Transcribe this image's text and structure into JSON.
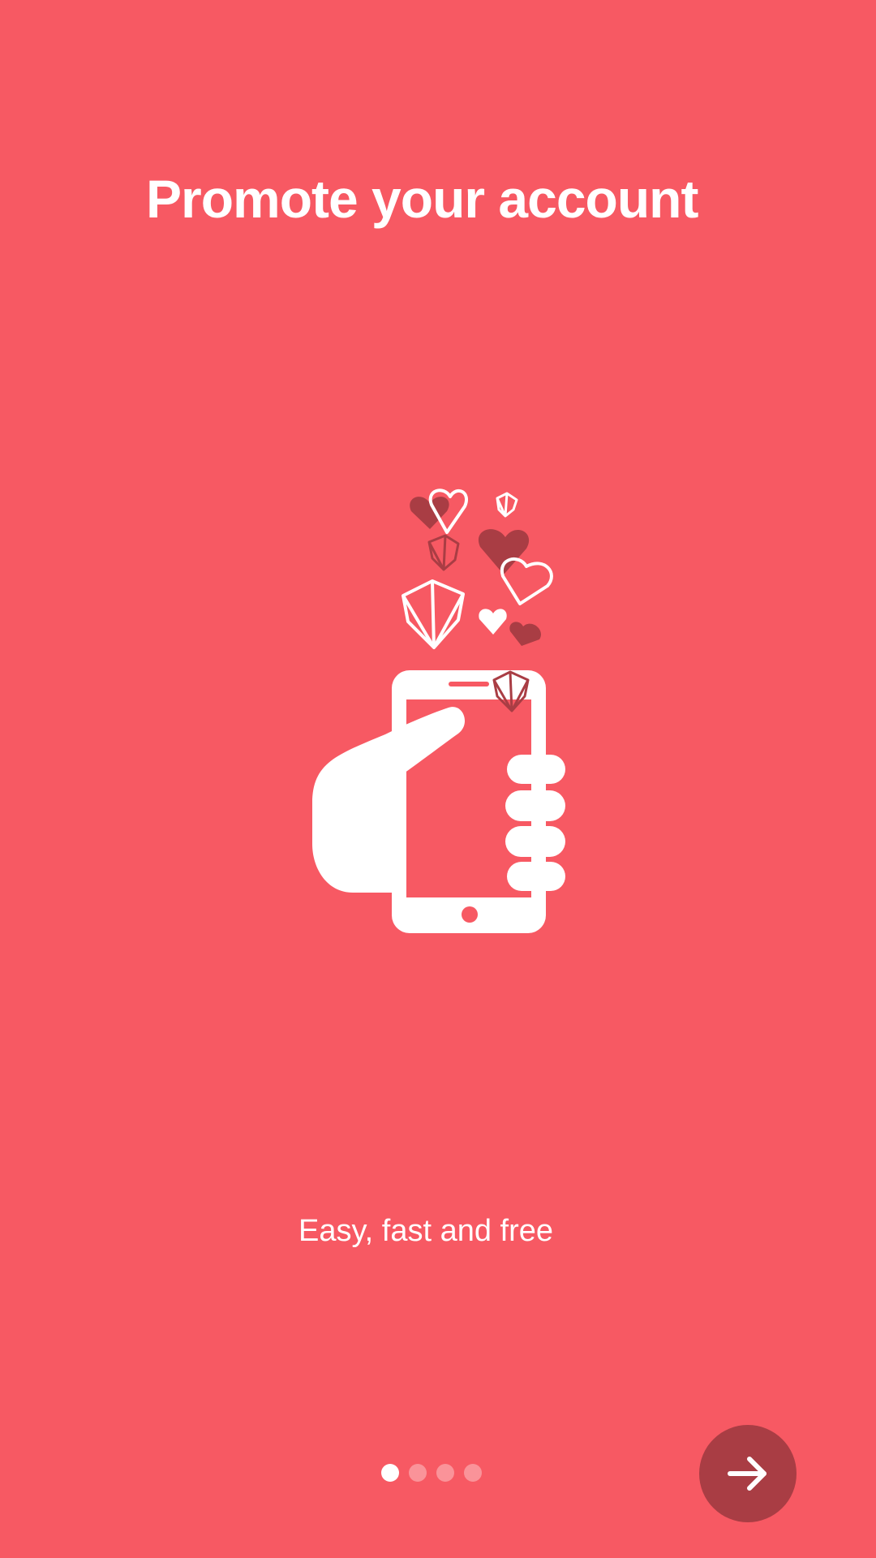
{
  "onboarding": {
    "title": "Promote your account",
    "subtitle": "Easy, fast and free",
    "page_indicator": {
      "total_pages": 4,
      "current_page": 1
    },
    "next_button_icon": "arrow-right-icon",
    "illustration_icon": "hand-holding-phone-with-hearts-and-diamonds-icon"
  },
  "colors": {
    "background": "#F75963",
    "accent_dark": "#A93D44",
    "text": "#FFFFFF"
  }
}
